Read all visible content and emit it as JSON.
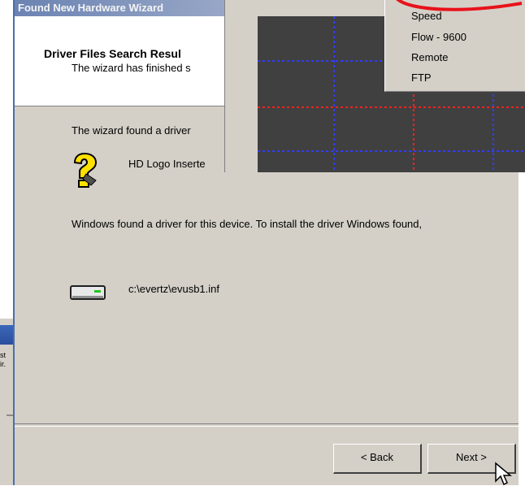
{
  "window": {
    "title": "Found New Hardware Wizard"
  },
  "header": {
    "title": "Driver Files Search Resul",
    "subtitle": "The wizard has finished s"
  },
  "body": {
    "line1": "The wizard found a driver",
    "device_name": "HD Logo Inserte",
    "line2": "Windows found a driver for this device. To install the driver Windows found,",
    "driver_path": "c:\\evertz\\evusb1.inf"
  },
  "buttons": {
    "back": "< Back",
    "next": "Next >"
  },
  "overlay_menu": {
    "items": [
      "Speed",
      "Flow - 9600",
      "Remote",
      "FTP"
    ]
  },
  "background_window": {
    "text_line1": "st",
    "text_line2": "ir."
  },
  "colors": {
    "dialog_bg": "#d4d0c8",
    "title_gradient_start": "#6b83b3",
    "grid_bg": "#404040",
    "grid_line_blue": "#2f3cff",
    "grid_line_red": "#ff2020",
    "annotation_red": "#e8121a"
  },
  "icons": {
    "help": "question-mark-icon",
    "drive": "disk-drive-icon",
    "cursor": "mouse-pointer-icon"
  }
}
